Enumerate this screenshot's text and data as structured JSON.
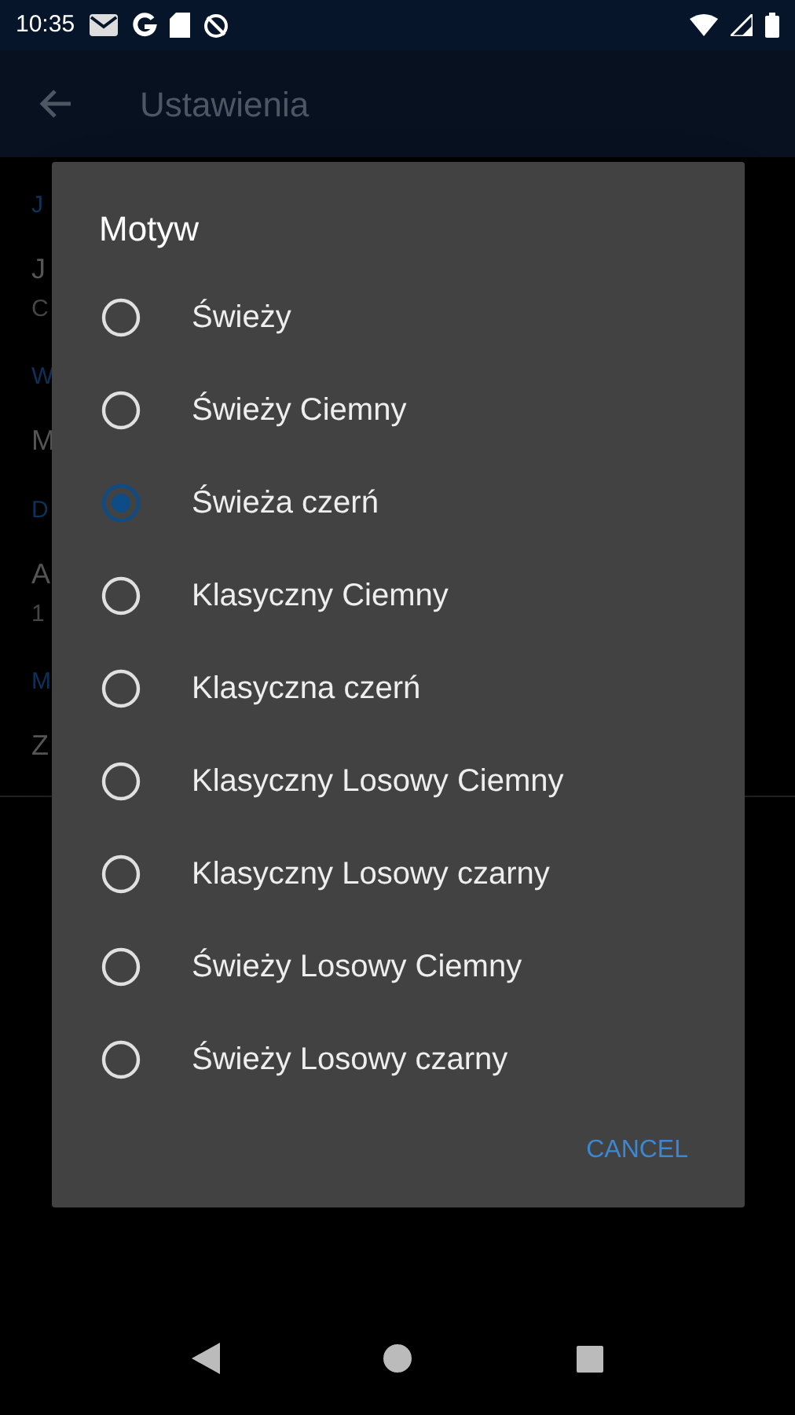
{
  "status_bar": {
    "time": "10:35"
  },
  "app_bar": {
    "title": "Ustawienia"
  },
  "background_settings": [
    {
      "kind": "header",
      "text": "J"
    },
    {
      "kind": "title",
      "text": "J"
    },
    {
      "kind": "subtitle",
      "text": "C"
    },
    {
      "kind": "header",
      "text": "W"
    },
    {
      "kind": "title",
      "text": "M"
    },
    {
      "kind": "header",
      "text": "D"
    },
    {
      "kind": "title",
      "text": "A"
    },
    {
      "kind": "subtitle",
      "text": "1"
    },
    {
      "kind": "header",
      "text": "M"
    },
    {
      "kind": "title",
      "text": "Z"
    }
  ],
  "dialog": {
    "title": "Motyw",
    "options": [
      {
        "label": "Świeży",
        "selected": false
      },
      {
        "label": "Świeży Ciemny",
        "selected": false
      },
      {
        "label": "Świeża czerń",
        "selected": true
      },
      {
        "label": "Klasyczny Ciemny",
        "selected": false
      },
      {
        "label": "Klasyczna czerń",
        "selected": false
      },
      {
        "label": "Klasyczny Losowy Ciemny",
        "selected": false
      },
      {
        "label": "Klasyczny Losowy czarny",
        "selected": false
      },
      {
        "label": "Świeży Losowy Ciemny",
        "selected": false
      },
      {
        "label": "Świeży Losowy czarny",
        "selected": false
      }
    ],
    "cancel": "CANCEL"
  }
}
